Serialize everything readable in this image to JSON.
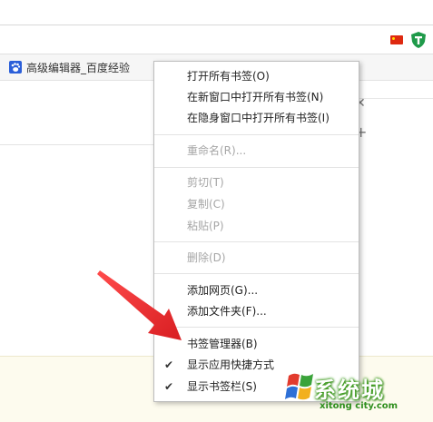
{
  "bookmarks_bar": {
    "item_label": "高级编辑器_百度经验"
  },
  "context_menu": {
    "items": [
      {
        "label": "打开所有书签(O)",
        "enabled": true
      },
      {
        "label": "在新窗口中打开所有书签(N)",
        "enabled": true
      },
      {
        "label": "在隐身窗口中打开所有书签(I)",
        "enabled": true
      },
      {
        "label": "重命名(R)...",
        "enabled": false
      },
      {
        "label": "剪切(T)",
        "enabled": false
      },
      {
        "label": "复制(C)",
        "enabled": false
      },
      {
        "label": "粘贴(P)",
        "enabled": false
      },
      {
        "label": "删除(D)",
        "enabled": false
      },
      {
        "label": "添加网页(G)...",
        "enabled": true
      },
      {
        "label": "添加文件夹(F)...",
        "enabled": true
      },
      {
        "label": "书签管理器(B)",
        "enabled": true
      },
      {
        "label": "显示应用快捷方式",
        "enabled": true,
        "checked": true
      },
      {
        "label": "显示书签栏(S)",
        "enabled": true,
        "checked": true
      }
    ]
  },
  "watermark": {
    "title": "系统城",
    "subtitle": "xitong city.com"
  },
  "colors": {
    "arrow": "#e8262a",
    "disabled_text": "#a6a6a6",
    "watermark_green": "#3a9a1a",
    "bottom_panel": "#fdfbee"
  },
  "icons": {
    "flag": "china-flag-icon",
    "extension": "shield-t-icon",
    "bookmark": "baidu-paw-icon",
    "check": "checkmark-icon"
  }
}
